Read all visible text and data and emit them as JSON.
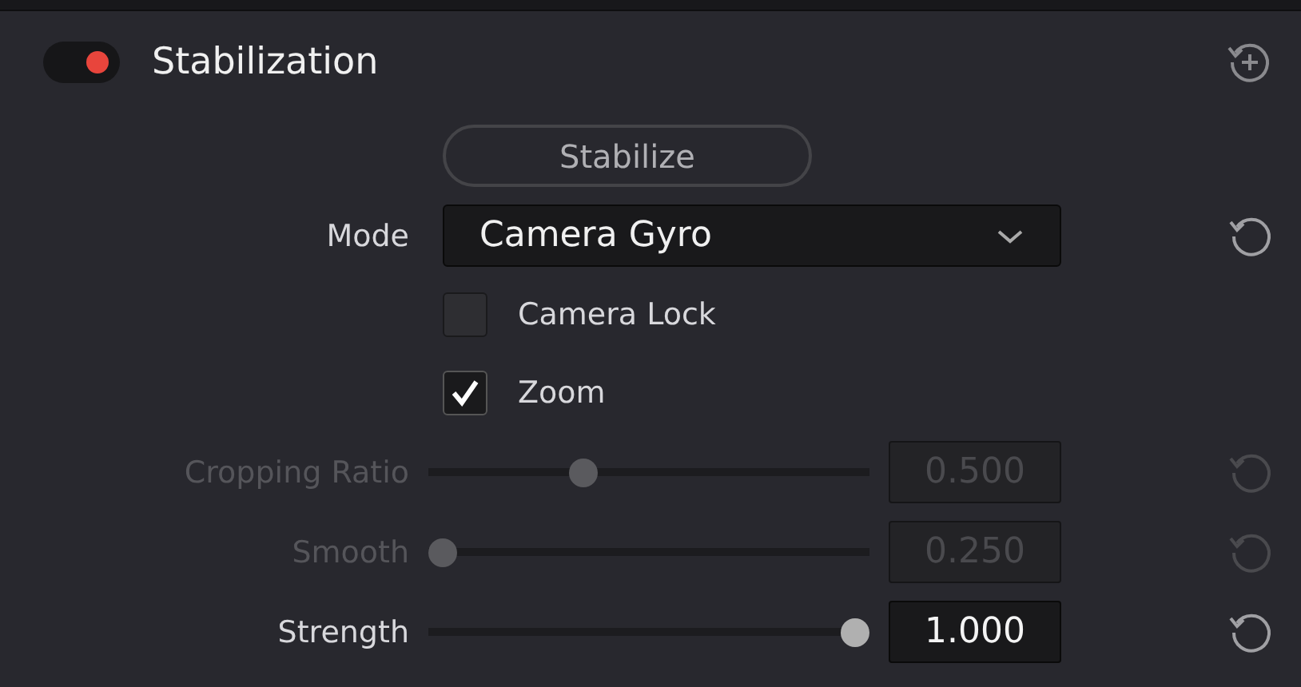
{
  "header": {
    "title": "Stabilization",
    "on": true
  },
  "rows": [
    {
      "kind": "button",
      "label": "Stabilize"
    },
    {
      "kind": "dropdown",
      "label": "Mode",
      "value": "Camera Gyro"
    },
    {
      "kind": "checkbox",
      "label": "Camera Lock",
      "checked": false
    },
    {
      "kind": "checkbox",
      "label": "Zoom",
      "checked": true
    },
    {
      "kind": "slider",
      "label": "Cropping Ratio",
      "level": 0.34,
      "reading": "0.500",
      "disabled": true
    },
    {
      "kind": "slider",
      "label": "Smooth",
      "level": 0.0,
      "reading": "0.250",
      "disabled": true
    },
    {
      "kind": "slider",
      "label": "Strength",
      "level": 1.0,
      "reading": "1.000",
      "disabled": false
    }
  ]
}
